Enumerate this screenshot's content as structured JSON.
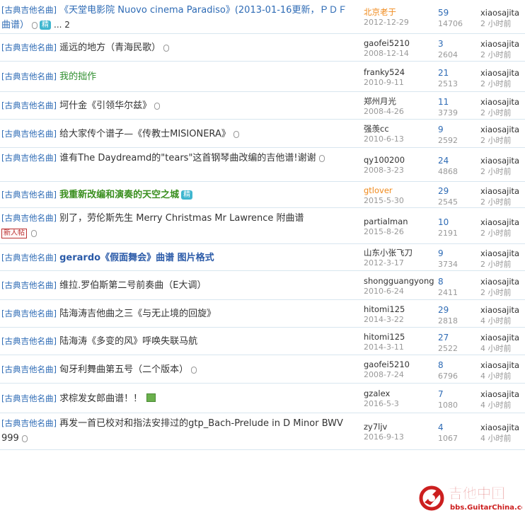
{
  "threads": [
    {
      "category": "[古典吉他名曲]",
      "title": "《天堂电影院 Nuovo cinema Paradiso》(2013-01-16更新，ＰＤＦ曲谱）",
      "style": "blue",
      "attach": true,
      "jing": "精",
      "pages": "... 2",
      "author": "北京老于",
      "author_style": "orange",
      "date": "2012-12-29",
      "replies": "59",
      "views": "14706",
      "last_user": "xiaosajita",
      "last_time": "2 小时前"
    },
    {
      "category": "[古典吉他名曲]",
      "title": "遥远的地方（青海民歌）",
      "style": "",
      "attach": true,
      "author": "gaofei5210",
      "date": "2008-12-14",
      "replies": "3",
      "views": "2604",
      "last_user": "xiaosajita",
      "last_time": "2 小时前"
    },
    {
      "category": "[古典吉他名曲]",
      "title": "我的拙作",
      "style": "green",
      "attach": false,
      "author": "franky524",
      "date": "2010-9-11",
      "replies": "21",
      "views": "2513",
      "last_user": "xiaosajita",
      "last_time": "2 小时前"
    },
    {
      "category": "[古典吉他名曲]",
      "title": "坷什金《引领华尔兹》",
      "style": "",
      "attach": true,
      "author": "郑州月光",
      "date": "2008-4-26",
      "replies": "11",
      "views": "3739",
      "last_user": "xiaosajita",
      "last_time": "2 小时前"
    },
    {
      "category": "[古典吉他名曲]",
      "title": "给大家传个谱子—《传教士MISIONERA》",
      "style": "",
      "attach": true,
      "author": "强羡cc",
      "date": "2010-6-13",
      "replies": "9",
      "views": "2592",
      "last_user": "xiaosajita",
      "last_time": "2 小时前"
    },
    {
      "category": "[古典吉他名曲]",
      "title": "谁有The Daydreamd的\"tears\"这首钢琴曲改编的吉他谱!谢谢",
      "style": "",
      "attach": true,
      "author": "qy100200",
      "date": "2008-3-23",
      "replies": "24",
      "views": "4868",
      "last_user": "xiaosajita",
      "last_time": "2 小时前"
    },
    {
      "category": "[古典吉他名曲]",
      "title": "我重新改编和演奏的天空之城",
      "style": "greenbold",
      "attach": false,
      "jing": "精",
      "author": "gtlover",
      "author_style": "orange",
      "date": "2015-5-30",
      "replies": "29",
      "views": "2545",
      "last_user": "xiaosajita",
      "last_time": "2 小时前"
    },
    {
      "category": "[古典吉他名曲]",
      "title": "别了，劳伦斯先生 Merry Christmas Mr Lawrence 附曲谱",
      "style": "",
      "attach": true,
      "newbadge": "新人帖",
      "author": "partialman",
      "date": "2015-8-26",
      "replies": "10",
      "views": "2191",
      "last_user": "xiaosajita",
      "last_time": "2 小时前"
    },
    {
      "category": "[古典吉他名曲]",
      "title": "gerardo《假面舞会》曲谱 图片格式",
      "style": "bluebold",
      "attach": false,
      "author": "山东小张飞刀",
      "date": "2012-3-17",
      "replies": "9",
      "views": "3734",
      "last_user": "xiaosajita",
      "last_time": "2 小时前"
    },
    {
      "category": "[古典吉他名曲]",
      "title": "维拉.罗伯斯第二号前奏曲（E大调）",
      "style": "",
      "attach": false,
      "author": "shongguangyong",
      "date": "2010-6-24",
      "replies": "8",
      "views": "2411",
      "last_user": "xiaosajita",
      "last_time": "2 小时前"
    },
    {
      "category": "[古典吉他名曲]",
      "title": "陆海涛吉他曲之三《与无止境的回旋》",
      "style": "",
      "attach": false,
      "author": "hitomi125",
      "date": "2014-3-22",
      "replies": "29",
      "views": "2818",
      "last_user": "xiaosajita",
      "last_time": "4 小时前"
    },
    {
      "category": "[古典吉他名曲]",
      "title": "陆海涛《多变的风》呼唤失联马航",
      "style": "",
      "attach": false,
      "author": "hitomi125",
      "date": "2014-3-11",
      "replies": "27",
      "views": "2522",
      "last_user": "xiaosajita",
      "last_time": "4 小时前"
    },
    {
      "category": "[古典吉他名曲]",
      "title": "匈牙利舞曲第五号（二个版本）",
      "style": "",
      "attach": true,
      "author": "gaofei5210",
      "date": "2008-7-24",
      "replies": "8",
      "views": "6796",
      "last_user": "xiaosajita",
      "last_time": "4 小时前"
    },
    {
      "category": "[古典吉他名曲]",
      "title": "求棕发女郎曲谱！！",
      "style": "",
      "attach": false,
      "image": true,
      "author": "gzalex",
      "date": "2016-5-3",
      "replies": "7",
      "views": "1080",
      "last_user": "xiaosajita",
      "last_time": "4 小时前"
    },
    {
      "category": "[古典吉他名曲]",
      "title": "再发一首已校对和指法安排过的gtp_Bach-Prelude in D Minor BWV 999",
      "style": "",
      "attach": true,
      "author": "zy7ljv",
      "date": "2016-9-13",
      "replies": "4",
      "views": "1067",
      "last_user": "xiaosajita",
      "last_time": "4 小时前"
    }
  ],
  "watermark": {
    "brand": "吉他中国",
    "site": "bbs.GuitarChina.com"
  },
  "colors": {
    "category": "#2e6bb5",
    "divider": "#d8e6ef",
    "orange_author": "#f08a1c",
    "green_title": "#2f8f2f",
    "watermark_red": "#cc1f1f"
  }
}
